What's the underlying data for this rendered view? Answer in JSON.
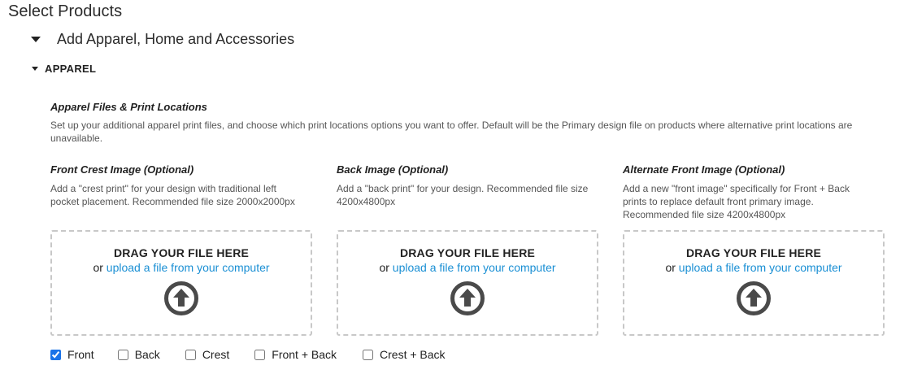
{
  "page_title": "Select Products",
  "section": {
    "label": "Add Apparel, Home and Accessories"
  },
  "apparel": {
    "label": "APPAREL"
  },
  "files": {
    "heading": "Apparel Files & Print Locations",
    "description": "Set up your additional apparel print files, and choose which print locations options you want to offer. Default will be the Primary design file on products where alternative print locations are unavailable."
  },
  "upload_columns": [
    {
      "title": "Front Crest Image (Optional)",
      "description": "Add a \"crest print\" for your design with traditional left pocket placement. Recommended file size 2000x2000px",
      "drag_text": "DRAG YOUR FILE HERE",
      "or_text": "or",
      "link_text": "upload a file from your computer"
    },
    {
      "title": "Back Image (Optional)",
      "description": "Add a \"back print\" for your design. Recommended file size 4200x4800px",
      "drag_text": "DRAG YOUR FILE HERE",
      "or_text": "or",
      "link_text": "upload a file from your computer"
    },
    {
      "title": "Alternate Front Image (Optional)",
      "description": "Add a new \"front image\" specifically for Front + Back prints to replace default front primary image. Recommended file size 4200x4800px",
      "drag_text": "DRAG YOUR FILE HERE",
      "or_text": "or",
      "link_text": "upload a file from your computer"
    }
  ],
  "print_locations": [
    {
      "label": "Front",
      "checked": true
    },
    {
      "label": "Back",
      "checked": false
    },
    {
      "label": "Crest",
      "checked": false
    },
    {
      "label": "Front + Back",
      "checked": false
    },
    {
      "label": "Crest + Back",
      "checked": false
    }
  ],
  "colors": {
    "link": "#1a8fd4",
    "icon": "#4a4a4a",
    "checkbox_accent": "#1a73e8"
  },
  "icons": {
    "section_toggle": "caret-down-icon",
    "apparel_toggle": "caret-down-icon",
    "upload": "upload-arrow-circle-icon"
  }
}
